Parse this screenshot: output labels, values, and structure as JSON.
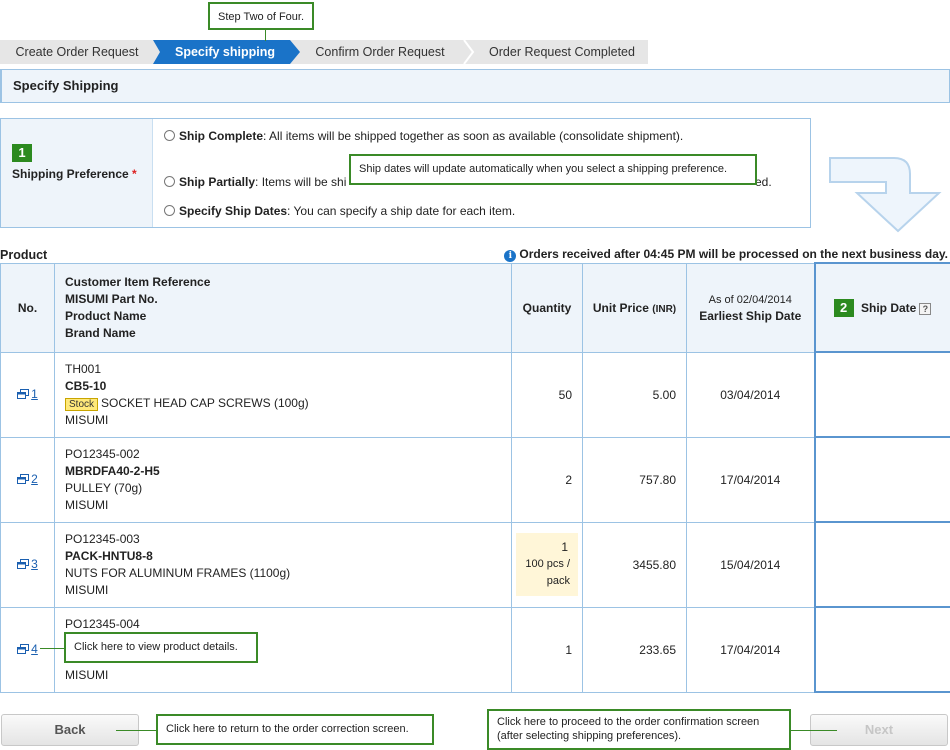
{
  "callouts": {
    "step": "Step Two of Four.",
    "ship_dates": "Ship dates will update automatically when you select a shipping preference.",
    "product_details": "Click here to view product details.",
    "back": "Click here to return to the order correction screen.",
    "next_line1": "Click here to proceed to the order confirmation screen",
    "next_line2": "(after selecting shipping preferences)."
  },
  "steps": [
    {
      "label": "Create Order Request"
    },
    {
      "label": "Specify shipping"
    },
    {
      "label": "Confirm Order Request"
    },
    {
      "label": "Order Request Completed"
    }
  ],
  "section_title": "Specify Shipping",
  "shipping_pref": {
    "badge": "1",
    "label": "Shipping Preference",
    "required": "*",
    "options": [
      {
        "title": "Ship Complete",
        "desc": ": All items will be shipped together as soon as available (consolidate shipment)."
      },
      {
        "title": "Ship Partially",
        "desc_start": ": Items will be shi",
        "desc_end": "ed."
      },
      {
        "title": "Specify Ship Dates",
        "desc": ": You can specify a ship date for each item."
      }
    ]
  },
  "product_heading": "Product",
  "notice": "Orders received after 04:45 PM will be processed on the next business day.",
  "table": {
    "headers": {
      "no": "No.",
      "desc_lines": [
        "Customer Item Reference",
        "MISUMI Part No.",
        "Product Name",
        "Brand Name"
      ],
      "quantity": "Quantity",
      "unit_price": "Unit Price",
      "unit_price_currency": "(INR)",
      "as_of": "As of 02/04/2014",
      "earliest": "Earliest Ship Date",
      "ship_badge": "2",
      "ship_date": "Ship Date",
      "help": "?"
    },
    "rows": [
      {
        "no": "1",
        "ref": "TH001",
        "part": "CB5-10",
        "stock": "Stock",
        "name": "SOCKET HEAD CAP SCREWS (100g)",
        "brand": "MISUMI",
        "qty": "50",
        "pack": "",
        "price": "5.00",
        "date": "03/04/2014"
      },
      {
        "no": "2",
        "ref": "PO12345-002",
        "part": "MBRDFA40-2-H5",
        "stock": "",
        "name": "PULLEY (70g)",
        "brand": "MISUMI",
        "qty": "2",
        "pack": "",
        "price": "757.80",
        "date": "17/04/2014"
      },
      {
        "no": "3",
        "ref": "PO12345-003",
        "part": "PACK-HNTU8-8",
        "stock": "",
        "name": "NUTS FOR ALUMINUM FRAMES (1100g)",
        "brand": "MISUMI",
        "qty": "1",
        "pack_line1": "100 pcs /",
        "pack_line2": "pack",
        "price": "3455.80",
        "date": "15/04/2014"
      },
      {
        "no": "4",
        "ref": "PO12345-004",
        "part": "",
        "stock": "",
        "name": "",
        "brand": "MISUMI",
        "qty": "1",
        "pack": "",
        "price": "233.65",
        "date": "17/04/2014"
      }
    ]
  },
  "buttons": {
    "back": "Back",
    "next": "Next"
  },
  "colors": {
    "accent": "#1a73c8",
    "callout_border": "#3a8a27",
    "table_border": "#9cc3e4"
  }
}
